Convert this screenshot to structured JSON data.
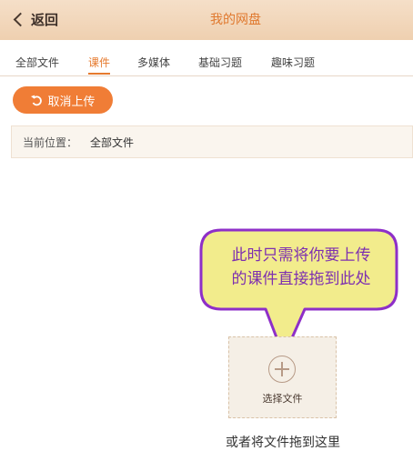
{
  "header": {
    "back_label": "返回",
    "title": "我的网盘"
  },
  "tabs": [
    {
      "label": "全部文件",
      "active": false
    },
    {
      "label": "课件",
      "active": true
    },
    {
      "label": "多媒体",
      "active": false
    },
    {
      "label": "基础习题",
      "active": false
    },
    {
      "label": "趣味习题",
      "active": false
    }
  ],
  "toolbar": {
    "cancel_upload_label": "取消上传"
  },
  "location": {
    "label": "当前位置：",
    "value": "全部文件"
  },
  "callout": {
    "line1": "此时只需将你要上传",
    "line2": "的课件直接拖到此处"
  },
  "upload": {
    "select_label": "选择文件",
    "drag_hint": "或者将文件拖到这里"
  },
  "colors": {
    "accent": "#f07d36",
    "callout_fill": "#f2ec8c",
    "callout_border": "#8e2fc8",
    "callout_text": "#7d2fb0"
  }
}
